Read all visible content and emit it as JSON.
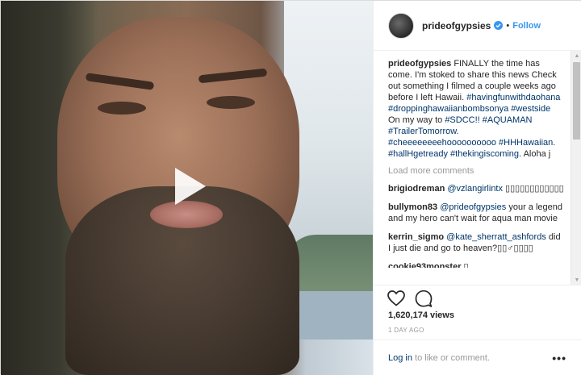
{
  "post": {
    "username": "prideofgypsies",
    "follow_label": "Follow",
    "separator": "•",
    "verified_icon": "verified-badge-icon",
    "caption_text": "FINALLY the time has come. I'm stoked to share this news Check out something I filmed a couple weeks ago before I left Hawaii.",
    "caption_tags_1": "#havingfunwithdaohana #droppinghawaiianbombsonya #westside",
    "caption_text_2": "On my way to",
    "caption_tag_sdcc": "#SDCC!! #AQUAMAN #TrailerTomorrow.",
    "caption_tags_3": "#cheeeeeeeehoooooooooo #HHHawaiian. #hallHgetready #thekingiscoming.",
    "caption_text_3": "Aloha j",
    "load_more": "Load more comments",
    "views": "1,620,174 views",
    "date": "1 DAY AGO",
    "login_link": "Log in",
    "login_rest": " to like or comment.",
    "more_options": "•••"
  },
  "comments": [
    {
      "user": "brigiodreman",
      "mention": "@vzlangirlintx",
      "text": " ▯▯▯▯▯▯▯▯▯▯▯▯"
    },
    {
      "user": "bullymon83",
      "mention": "@prideofgypsies",
      "text": " your a legend and my hero can't wait for aqua man movie"
    },
    {
      "user": "kerrin_sigmo",
      "mention": "@kate_sherratt_ashfords",
      "text": " did I just die and go to heaven?▯▯♂▯▯▯▯"
    },
    {
      "user": "cookie93monster",
      "mention": "",
      "text": " ▯"
    }
  ],
  "colors": {
    "link_blue": "#3897f0",
    "tag_blue": "#003569",
    "muted": "#999999"
  }
}
